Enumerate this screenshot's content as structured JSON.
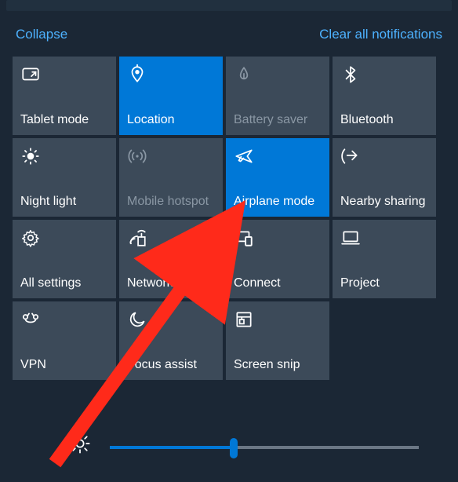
{
  "header": {
    "collapse": "Collapse",
    "clear": "Clear all notifications"
  },
  "tiles": [
    {
      "id": "tablet-mode",
      "label": "Tablet mode",
      "icon": "tablet-mode-icon",
      "state": "normal"
    },
    {
      "id": "location",
      "label": "Location",
      "icon": "location-icon",
      "state": "active"
    },
    {
      "id": "battery-saver",
      "label": "Battery saver",
      "icon": "battery-saver-icon",
      "state": "disabled"
    },
    {
      "id": "bluetooth",
      "label": "Bluetooth",
      "icon": "bluetooth-icon",
      "state": "normal"
    },
    {
      "id": "night-light",
      "label": "Night light",
      "icon": "night-light-icon",
      "state": "normal"
    },
    {
      "id": "mobile-hotspot",
      "label": "Mobile hotspot",
      "icon": "mobile-hotspot-icon",
      "state": "disabled"
    },
    {
      "id": "airplane-mode",
      "label": "Airplane mode",
      "icon": "airplane-icon",
      "state": "active"
    },
    {
      "id": "nearby-sharing",
      "label": "Nearby sharing",
      "icon": "nearby-sharing-icon",
      "state": "normal"
    },
    {
      "id": "all-settings",
      "label": "All settings",
      "icon": "settings-icon",
      "state": "normal"
    },
    {
      "id": "network",
      "label": "Network",
      "icon": "network-icon",
      "state": "normal"
    },
    {
      "id": "connect",
      "label": "Connect",
      "icon": "connect-icon",
      "state": "normal"
    },
    {
      "id": "project",
      "label": "Project",
      "icon": "project-icon",
      "state": "normal"
    },
    {
      "id": "vpn",
      "label": "VPN",
      "icon": "vpn-icon",
      "state": "normal"
    },
    {
      "id": "focus-assist",
      "label": "Focus assist",
      "icon": "focus-assist-icon",
      "state": "normal"
    },
    {
      "id": "screen-snip",
      "label": "Screen snip",
      "icon": "screen-snip-icon",
      "state": "normal"
    }
  ],
  "brightness": {
    "value": 40,
    "min": 0,
    "max": 100
  },
  "annotation": {
    "target": "airplane-mode",
    "color": "#ff2a1a"
  }
}
